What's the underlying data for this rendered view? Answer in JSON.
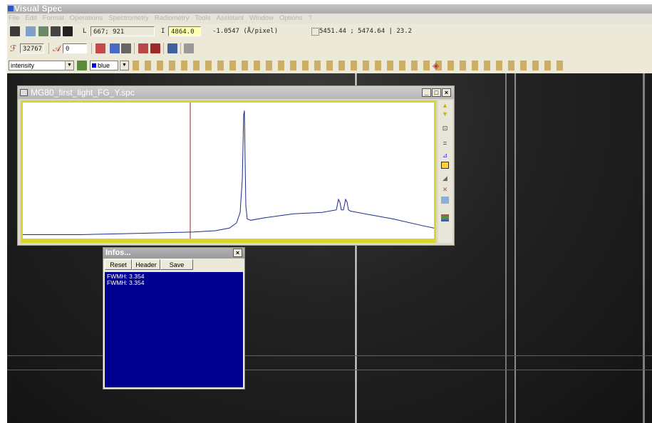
{
  "app": {
    "title": "Visual Spec"
  },
  "menu": [
    "File",
    "Edit",
    "Format",
    "Operations",
    "Spectrometry",
    "Radiometry",
    "Tools",
    "Assistant",
    "Window",
    "Options",
    "?"
  ],
  "toolbar1": {
    "lambda_label": "L",
    "lambda_value": "667; 921",
    "intensity_label": "I",
    "intensity_value": "4864.0",
    "dispersion": "-1.0547 (Å/pixel)",
    "range_readout": "5451.44 ; 5474.64 | 23.2"
  },
  "toolbar2": {
    "level_value": "32767",
    "offset_value": "0"
  },
  "toolbar3": {
    "profile_select": "intensity",
    "color_select": "blue",
    "colors": {
      "selected_color": "#0000ff"
    }
  },
  "spectrum_window": {
    "title": "MG80_first_light_FG_Y.spc",
    "min_btn": "_",
    "max_btn": "□",
    "close_btn": "×"
  },
  "infos_window": {
    "title": "Infos...",
    "close_btn": "×",
    "buttons": {
      "reset": "Reset",
      "header": "Header",
      "save": "Save"
    },
    "lines": [
      "FWMH: 3.354",
      "FWMH: 3.354"
    ]
  },
  "chart_data": {
    "type": "line",
    "title": "",
    "xlabel": "",
    "ylabel": "",
    "grid": false,
    "series": [
      {
        "color": "#1a2b8c",
        "x": [
          0,
          40,
          80,
          120,
          160,
          200,
          240,
          270,
          290,
          300,
          305,
          308,
          310,
          311,
          312,
          313,
          315,
          320,
          340,
          380,
          420,
          440,
          443,
          445,
          447,
          450,
          453,
          455,
          457,
          460,
          480,
          520,
          560,
          577
        ],
        "y": [
          0.03,
          0.03,
          0.03,
          0.035,
          0.04,
          0.045,
          0.05,
          0.06,
          0.08,
          0.12,
          0.2,
          0.45,
          0.95,
          0.98,
          0.6,
          0.25,
          0.15,
          0.14,
          0.16,
          0.19,
          0.2,
          0.22,
          0.3,
          0.28,
          0.22,
          0.22,
          0.3,
          0.28,
          0.22,
          0.21,
          0.19,
          0.15,
          0.1,
          0.08
        ]
      }
    ],
    "cursor_x": 235
  },
  "icons": [
    "split-icon",
    "open-icon",
    "image-icon",
    "print-icon",
    "save-icon"
  ]
}
